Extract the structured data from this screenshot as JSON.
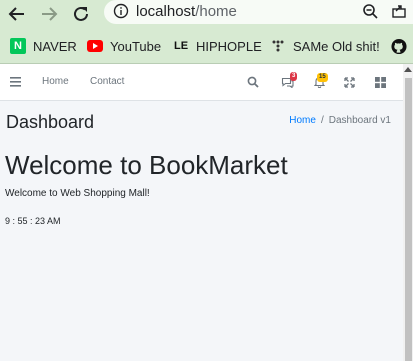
{
  "browser": {
    "url_host": "localhost",
    "url_path": "/home",
    "bookmarks": [
      {
        "label": "NAVER",
        "icon": "naver-icon"
      },
      {
        "label": "YouTube",
        "icon": "youtube-icon"
      },
      {
        "label": "HIPHOPLE",
        "icon": "hiphople-icon"
      },
      {
        "label": "SAMe Old shit!",
        "icon": "same-icon"
      },
      {
        "label": "",
        "icon": "github-icon"
      }
    ]
  },
  "navbar": {
    "links": [
      "Home",
      "Contact"
    ],
    "messages_badge": "3",
    "notifications_badge": "15",
    "colors": {
      "danger": "#dc3545",
      "warning": "#ffc107"
    }
  },
  "content": {
    "title": "Dashboard",
    "breadcrumb": {
      "home": "Home",
      "separator": "/",
      "current": "Dashboard v1"
    },
    "welcome": "Welcome to BookMarket",
    "subtitle": "Welcome to Web Shopping Mall!",
    "clock": "9 : 55 : 23 AM"
  }
}
